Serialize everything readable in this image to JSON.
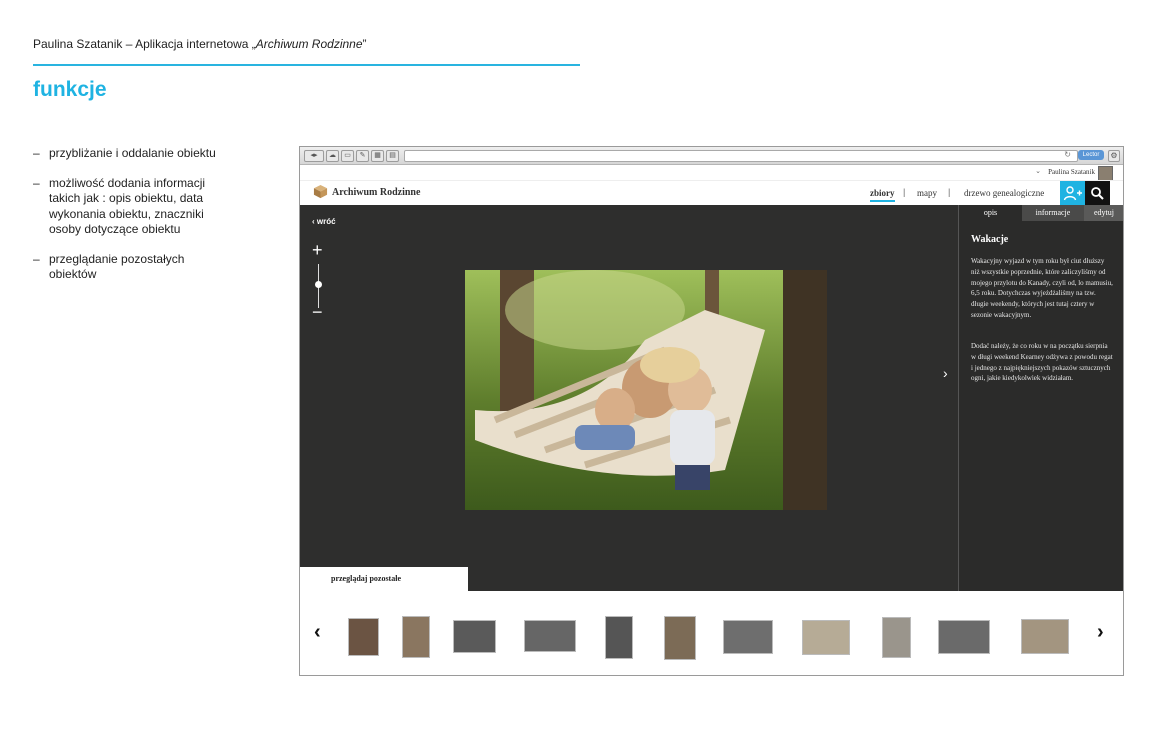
{
  "doc": {
    "header_prefix": "Paulina Szatanik – Aplikacja internetowa „",
    "header_title": "Archiwum Rodzinne",
    "header_suffix": "”",
    "section_title": "funkcje",
    "features": [
      "przybliżanie i oddalanie obiektu",
      "możliwość dodania informacji takich jak : opis obiektu, data wykonania obiektu, znaczniki osoby dotyczące obiektu",
      "przeglądanie pozostałych obiektów"
    ]
  },
  "browser": {
    "reader_label": "Lector",
    "reload_icon": "reload-icon"
  },
  "app": {
    "user_name": "Paulina Szatanik",
    "logo_text": "Archiwum Rodzinne",
    "nav": [
      "zbiory",
      "mapy",
      "drzewo genealogiczne"
    ],
    "active_nav": "zbiory",
    "back_label": "wróć",
    "zoom_plus": "+",
    "zoom_minus": "−",
    "next_arrow": "›",
    "tabs": [
      "opis",
      "informacje",
      "edytuj"
    ],
    "panel": {
      "title": "Wakacje",
      "paragraph1": "Wakacyjny wyjazd w tym roku był ciut dłuższy niż wszystkie poprzednie, które zaliczyliśmy od mojego przylotu do Kanady, czyli od, lo mamusiu, 6,5 roku. Dotychczas wyjeżdżaliśmy na tzw. długie weekendy, których jest tutaj cztery w sezonie wakacyjnym.",
      "paragraph2": "Dodać należy, że co roku w na początku sierpnia w długi weekend Kearney odżywa z powodu regat i jednego z najpiękniejszych pokazów sztucznych ogni, jakie kiedykolwiek widziałam."
    },
    "browse_label": "przeglądaj pozostałe",
    "strip_prev": "‹",
    "strip_next": "›",
    "colors": {
      "accent": "#1fb3e2",
      "stage": "#2e2e2d",
      "panel": "#2b2b2a"
    }
  }
}
